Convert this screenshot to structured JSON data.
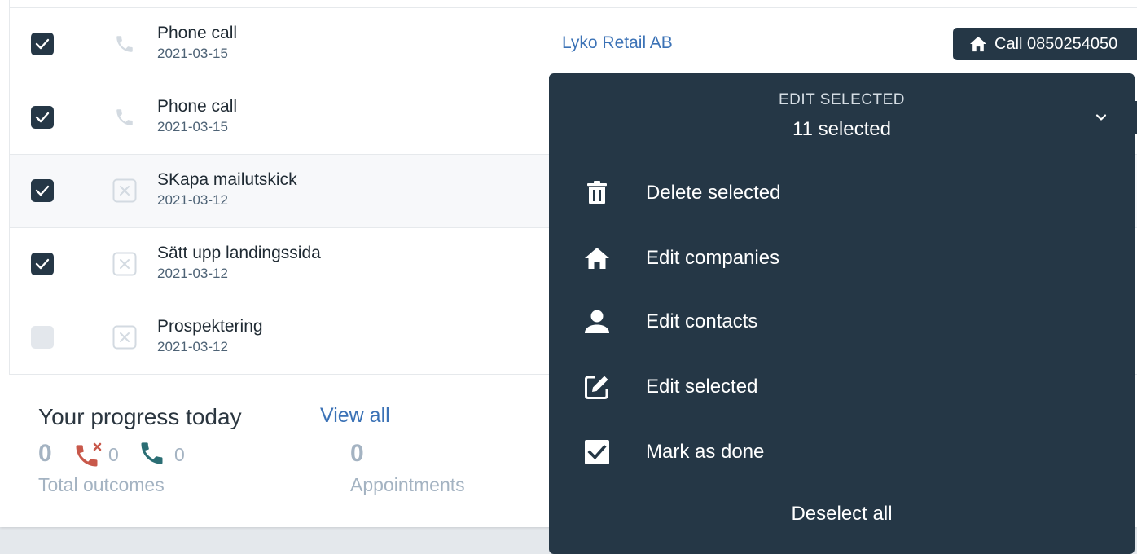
{
  "tasks": [
    {
      "title": "Phone call",
      "date": "2021-03-15",
      "checked": true,
      "type_icon": "phone-icon",
      "company": "Lyko Retail AB",
      "call_label": "Call 0850254050"
    },
    {
      "title": "Phone call",
      "date": "2021-03-15",
      "checked": true,
      "type_icon": "phone-icon"
    },
    {
      "title": "SKapa mailutskick",
      "date": "2021-03-12",
      "checked": true,
      "type_icon": "task-x-icon"
    },
    {
      "title": "Sätt upp landingssida",
      "date": "2021-03-12",
      "checked": true,
      "type_icon": "task-x-icon"
    },
    {
      "title": "Prospektering",
      "date": "2021-03-12",
      "checked": false,
      "type_icon": "task-x-icon"
    }
  ],
  "progress": {
    "title": "Your progress today",
    "view_all": "View all",
    "total_outcomes_value": "0",
    "total_outcomes_label": "Total outcomes",
    "missed_calls_value": "0",
    "completed_calls_value": "0",
    "appointments_value": "0",
    "appointments_label": "Appointments"
  },
  "menu": {
    "header": "EDIT SELECTED",
    "count": "11 selected",
    "items": [
      {
        "label": "Delete selected",
        "icon": "trash-icon"
      },
      {
        "label": "Edit companies",
        "icon": "home-icon"
      },
      {
        "label": "Edit contacts",
        "icon": "person-icon"
      },
      {
        "label": "Edit selected",
        "icon": "edit-icon"
      },
      {
        "label": "Mark as done",
        "icon": "checkbox-icon"
      }
    ],
    "deselect": "Deselect all"
  },
  "colors": {
    "navy": "#253746",
    "link": "#3b72b6",
    "missed": "#c8584a",
    "completed": "#2b6e74",
    "muted": "#a4b3c2"
  }
}
